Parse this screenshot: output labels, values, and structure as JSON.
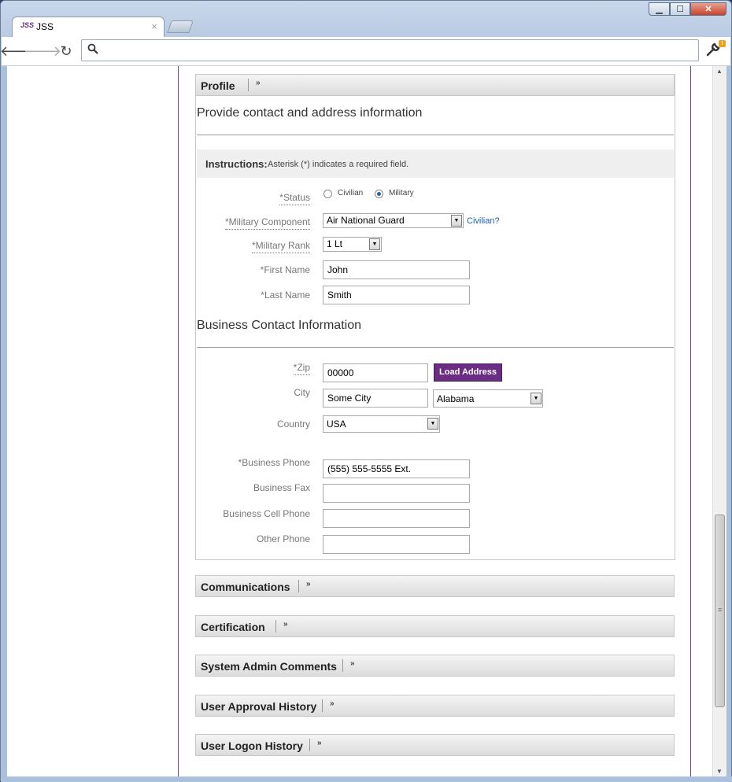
{
  "browser": {
    "tab_title": "JSS",
    "favicon_text": "JSS",
    "tab_close": "×",
    "url": "",
    "badge": "!"
  },
  "profile": {
    "section_label": "Profile",
    "heading": "Provide contact and address information",
    "instructions_label": "Instructions:",
    "instructions_text": "Asterisk (*) indicates a required field.",
    "status_label": "*Status",
    "status_options": [
      "Civilian",
      "Military"
    ],
    "status_selected": "Military",
    "military_component_label": "*Military Component",
    "military_component_value": "Air National Guard",
    "civilian_link": "Civilian?",
    "military_rank_label": "*Military Rank",
    "military_rank_value": "1 Lt",
    "first_name_label": "*First Name",
    "first_name_value": "John",
    "last_name_label": "*Last Name",
    "last_name_value": "Smith"
  },
  "business": {
    "heading": "Business Contact Information",
    "zip_label": "*Zip",
    "zip_value": "00000",
    "load_address_button": "Load Address",
    "city_label": "City",
    "city_value": "Some City",
    "state_value": "Alabama",
    "country_label": "Country",
    "country_value": "USA",
    "business_phone_label": "*Business Phone",
    "business_phone_value": "(555) 555-5555 Ext.",
    "business_fax_label": "Business Fax",
    "business_fax_value": "",
    "business_cell_label": "Business Cell Phone",
    "business_cell_value": "",
    "other_phone_label": "Other Phone",
    "other_phone_value": ""
  },
  "sections": [
    {
      "label": "Communications"
    },
    {
      "label": "Certification"
    },
    {
      "label": "System Admin Comments"
    },
    {
      "label": "User Approval History"
    },
    {
      "label": "User Logon History"
    }
  ]
}
